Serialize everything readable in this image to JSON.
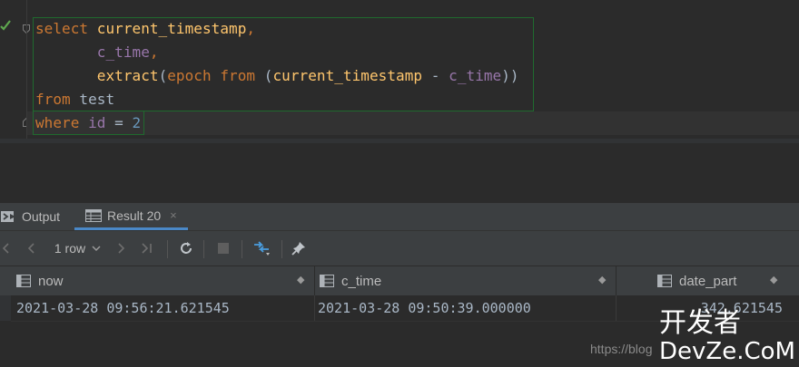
{
  "editor": {
    "lines": [
      {
        "tokens": [
          {
            "t": "select ",
            "c": "kw"
          },
          {
            "t": "current_timestamp",
            "c": "fn"
          },
          {
            "t": ",",
            "c": "kw"
          }
        ]
      },
      {
        "tokens": [
          {
            "t": "       ",
            "c": "plain"
          },
          {
            "t": "c_time",
            "c": "col"
          },
          {
            "t": ",",
            "c": "kw"
          }
        ]
      },
      {
        "tokens": [
          {
            "t": "       ",
            "c": "plain"
          },
          {
            "t": "extract",
            "c": "fn"
          },
          {
            "t": "(",
            "c": "plain"
          },
          {
            "t": "epoch",
            "c": "kw"
          },
          {
            "t": " ",
            "c": "plain"
          },
          {
            "t": "from",
            "c": "kw"
          },
          {
            "t": " (",
            "c": "plain"
          },
          {
            "t": "current_timestamp",
            "c": "fn"
          },
          {
            "t": " - ",
            "c": "plain"
          },
          {
            "t": "c_time",
            "c": "col"
          },
          {
            "t": "))",
            "c": "plain"
          }
        ]
      },
      {
        "tokens": [
          {
            "t": "from ",
            "c": "kw"
          },
          {
            "t": "test",
            "c": "plain"
          }
        ]
      },
      {
        "tokens": [
          {
            "t": "where ",
            "c": "kw"
          },
          {
            "t": "id",
            "c": "col"
          },
          {
            "t": " = ",
            "c": "plain"
          },
          {
            "t": "2",
            "c": "num"
          }
        ]
      }
    ]
  },
  "tabs": {
    "output_label": "Output",
    "result_label": "Result 20",
    "close_glyph": "×"
  },
  "toolbar": {
    "row_count": "1 row"
  },
  "table": {
    "columns": [
      "now",
      "c_time",
      "date_part"
    ],
    "rows": [
      [
        "2021-03-28 09:56:21.621545",
        "2021-03-28 09:50:39.000000",
        "342.621545"
      ]
    ]
  },
  "watermark": {
    "url": "https://blog",
    "logo_top": "开发者",
    "logo_bottom": "DevZe.CoM"
  },
  "colors": {
    "keyword": "#cc7832",
    "function": "#ffc66d",
    "column": "#9876aa",
    "number": "#6897bb",
    "plain": "#a9b7c6",
    "accent": "#4a88c7"
  }
}
